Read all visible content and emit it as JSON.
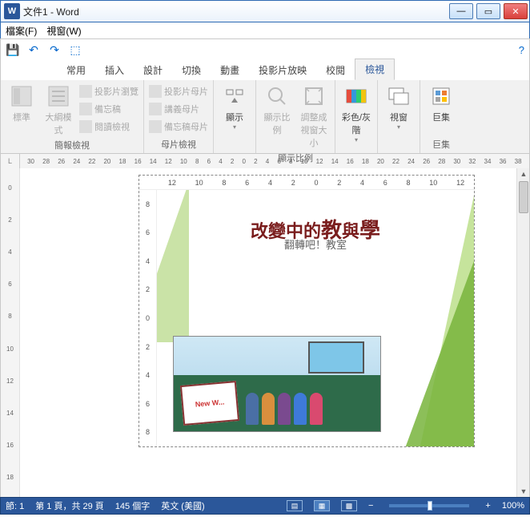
{
  "titlebar": {
    "app_icon": "W",
    "title": "文件1 - Word"
  },
  "menubar": {
    "file": "檔案(F)",
    "window": "視窗(W)"
  },
  "tabs": {
    "t1": "常用",
    "t2": "插入",
    "t3": "設計",
    "t4": "切換",
    "t5": "動畫",
    "t6": "投影片放映",
    "t7": "校閱",
    "t8": "檢視"
  },
  "ribbon": {
    "g1": {
      "label": "簡報檢視",
      "b1": "標準",
      "b2": "大綱模式",
      "s1": "投影片瀏覽",
      "s2": "備忘稿",
      "s3": "閱讀檢視"
    },
    "g2": {
      "label": "母片檢視",
      "s1": "投影片母片",
      "s2": "講義母片",
      "s3": "備忘稿母片"
    },
    "g3": {
      "label": "",
      "b1": "顯示"
    },
    "g4": {
      "label": "顯示比例",
      "b1": "顯示比例",
      "b2": "調整成視窗大小"
    },
    "g5": {
      "label": "",
      "b1": "彩色/灰階"
    },
    "g6": {
      "label": "",
      "b1": "視窗"
    },
    "g7": {
      "label": "巨集",
      "b1": "巨集"
    }
  },
  "hruler_top": [
    "30",
    "28",
    "26",
    "24",
    "22",
    "20",
    "18",
    "16",
    "14",
    "12",
    "10",
    "8",
    "6",
    "4",
    "2",
    "0",
    "2",
    "4",
    "6",
    "8",
    "10",
    "12",
    "14",
    "16",
    "18",
    "20",
    "22",
    "24",
    "26",
    "28",
    "30",
    "32",
    "34",
    "36",
    "38"
  ],
  "vruler": [
    "0",
    "2",
    "4",
    "6",
    "8",
    "10",
    "12",
    "14",
    "16",
    "18"
  ],
  "slide": {
    "hruler": [
      "12",
      "10",
      "8",
      "6",
      "4",
      "2",
      "0",
      "2",
      "4",
      "6",
      "8",
      "10",
      "12"
    ],
    "vruler": [
      "8",
      "6",
      "4",
      "2",
      "0",
      "2",
      "4",
      "6",
      "8"
    ],
    "title_pre": "改變中的",
    "title_mid": "教",
    "title_conj": "與",
    "title_end": "學",
    "subtitle": "翻轉吧！教室",
    "board_text": "New W..."
  },
  "status": {
    "section": "節: 1",
    "page": "第 1 頁，共 29 頁",
    "words": "145 個字",
    "lang": "英文 (美國)",
    "zoom_minus": "−",
    "zoom_plus": "+",
    "zoom": "100%"
  }
}
